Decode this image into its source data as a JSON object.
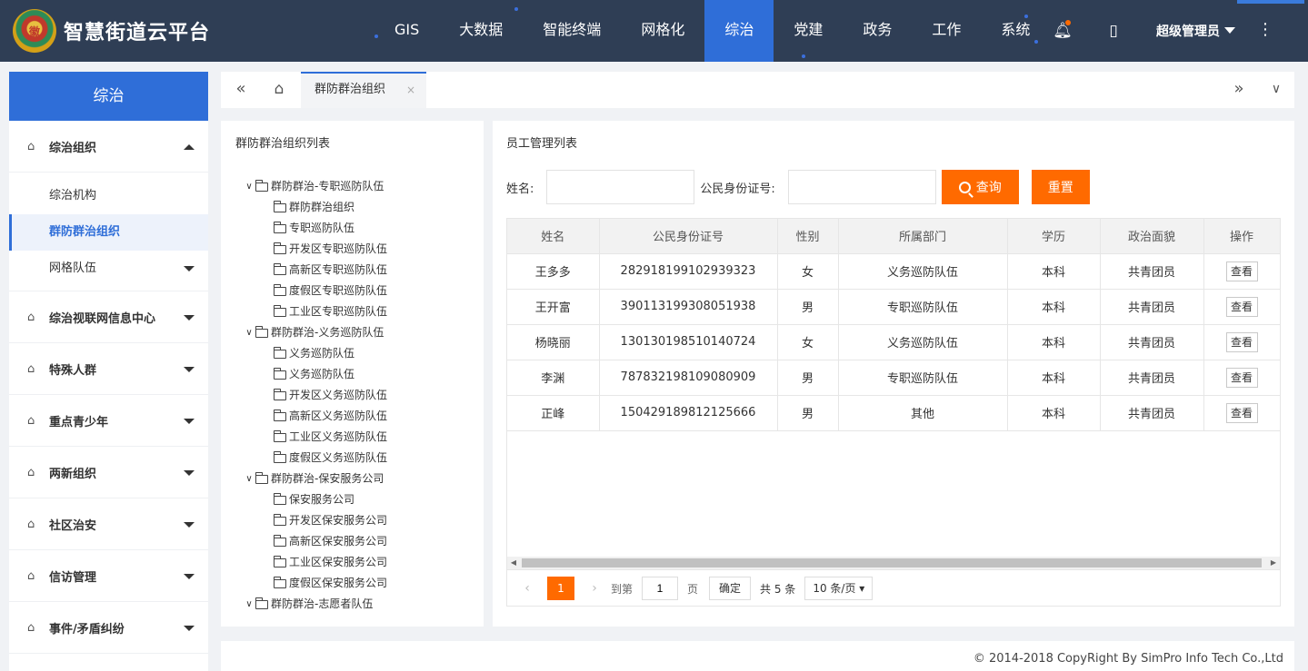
{
  "app": {
    "title": "智慧街道云平台",
    "emblem_text": "徽"
  },
  "nav": {
    "items": [
      {
        "label": "GIS"
      },
      {
        "label": "大数据"
      },
      {
        "label": "智能终端"
      },
      {
        "label": "网格化"
      },
      {
        "label": "综治",
        "active": true
      },
      {
        "label": "党建"
      },
      {
        "label": "政务"
      },
      {
        "label": "工作"
      },
      {
        "label": "系统"
      }
    ],
    "user": "超级管理员"
  },
  "sidebar": {
    "header": "综治",
    "groups": [
      {
        "label": "综治组织",
        "expanded": true
      },
      {
        "label": "综治视联网信息中心"
      },
      {
        "label": "特殊人群"
      },
      {
        "label": "重点青少年"
      },
      {
        "label": "两新组织"
      },
      {
        "label": "社区治安"
      },
      {
        "label": "信访管理"
      },
      {
        "label": "事件/矛盾纠纷"
      }
    ],
    "subitems": [
      {
        "label": "综治机构"
      },
      {
        "label": "群防群治组织",
        "active": true
      },
      {
        "label": "网格队伍"
      }
    ]
  },
  "tabs": {
    "items": [
      {
        "label": "群防群治组织",
        "close": "×"
      }
    ]
  },
  "tree": {
    "title": "群防群治组织列表",
    "nodes": [
      {
        "label": "群防群治-专职巡防队伍",
        "level": 0,
        "toggle": "∨"
      },
      {
        "label": "群防群治组织",
        "level": 1
      },
      {
        "label": "专职巡防队伍",
        "level": 1
      },
      {
        "label": "开发区专职巡防队伍",
        "level": 1
      },
      {
        "label": "高新区专职巡防队伍",
        "level": 1
      },
      {
        "label": "度假区专职巡防队伍",
        "level": 1
      },
      {
        "label": "工业区专职巡防队伍",
        "level": 1
      },
      {
        "label": "群防群治-义务巡防队伍",
        "level": 0,
        "toggle": "∨"
      },
      {
        "label": "义务巡防队伍",
        "level": 1
      },
      {
        "label": "义务巡防队伍",
        "level": 1
      },
      {
        "label": "开发区义务巡防队伍",
        "level": 1
      },
      {
        "label": "高新区义务巡防队伍",
        "level": 1
      },
      {
        "label": "工业区义务巡防队伍",
        "level": 1
      },
      {
        "label": "度假区义务巡防队伍",
        "level": 1
      },
      {
        "label": "群防群治-保安服务公司",
        "level": 0,
        "toggle": "∨"
      },
      {
        "label": "保安服务公司",
        "level": 1
      },
      {
        "label": "开发区保安服务公司",
        "level": 1
      },
      {
        "label": "高新区保安服务公司",
        "level": 1
      },
      {
        "label": "工业区保安服务公司",
        "level": 1
      },
      {
        "label": "度假区保安服务公司",
        "level": 1
      },
      {
        "label": "群防群治-志愿者队伍",
        "level": 0,
        "toggle": "∨"
      }
    ]
  },
  "list": {
    "title": "员工管理列表",
    "search": {
      "name_label": "姓名:",
      "name_value": "",
      "id_label": "公民身份证号:",
      "id_value": "",
      "search_button": "查询",
      "reset_button": "重置"
    },
    "columns": [
      "姓名",
      "公民身份证号",
      "性别",
      "所属部门",
      "学历",
      "政治面貌",
      "操作"
    ],
    "rows": [
      {
        "name": "王多多",
        "id": "282918199102939323",
        "gender": "女",
        "dept": "义务巡防队伍",
        "edu": "本科",
        "political": "共青团员",
        "action": "查看"
      },
      {
        "name": "王开富",
        "id": "390113199308051938",
        "gender": "男",
        "dept": "专职巡防队伍",
        "edu": "本科",
        "political": "共青团员",
        "action": "查看"
      },
      {
        "name": "杨晓丽",
        "id": "130130198510140724",
        "gender": "女",
        "dept": "义务巡防队伍",
        "edu": "本科",
        "political": "共青团员",
        "action": "查看"
      },
      {
        "name": "李渊",
        "id": "787832198109080909",
        "gender": "男",
        "dept": "专职巡防队伍",
        "edu": "本科",
        "political": "共青团员",
        "action": "查看"
      },
      {
        "name": "正峰",
        "id": "150429189812125666",
        "gender": "男",
        "dept": "其他",
        "edu": "本科",
        "political": "共青团员",
        "action": "查看"
      }
    ],
    "pager": {
      "current": "1",
      "goto_label": "到第",
      "goto_value": "1",
      "page_label": "页",
      "ok_label": "确定",
      "total": "共 5 条",
      "page_size": "10 条/页"
    }
  },
  "footer": {
    "copyright": "© 2014-2018 CopyRight By SimPro Info Tech Co.,Ltd"
  },
  "colors": {
    "nav_bg": "#2f3e55",
    "accent_blue": "#2f6ed8",
    "accent_orange": "#ff6a00"
  }
}
